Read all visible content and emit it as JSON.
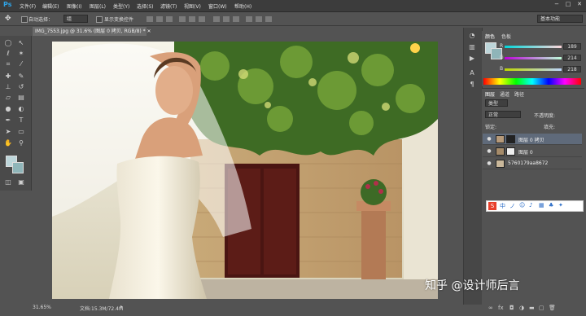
{
  "app": {
    "logo": "Ps"
  },
  "menu": [
    "文件(F)",
    "编辑(E)",
    "图像(I)",
    "图层(L)",
    "类型(Y)",
    "选择(S)",
    "滤镜(T)",
    "视图(V)",
    "窗口(W)",
    "帮助(H)"
  ],
  "window_controls": [
    "−",
    "□",
    "✕"
  ],
  "options": {
    "auto_select_label": "自动选择：",
    "auto_select_value": "组",
    "transform_label": "显示变换控件",
    "workspace": "基本功能"
  },
  "document": {
    "tab_title": "IMG_7553.jpg @ 31.6% (图层 0 拷贝, RGB/8) * ✕"
  },
  "status": {
    "zoom": "31.65%",
    "doc": "文档:15.3M/72.4M"
  },
  "color_panel": {
    "tabs": [
      "颜色",
      "色板"
    ],
    "sliders": [
      {
        "label": "R",
        "value": "189"
      },
      {
        "label": "G",
        "value": "214"
      },
      {
        "label": "B",
        "value": "218"
      }
    ],
    "foreground": "#bdd6da",
    "background": "#8fb5b9"
  },
  "layers_panel": {
    "tabs": [
      "图层",
      "通道",
      "路径"
    ],
    "kind_label": "类型",
    "blend_mode": "正常",
    "opacity_label": "不透明度:",
    "lock_label": "锁定:",
    "fill_label": "填充:",
    "layers": [
      {
        "name": "图层 0 拷贝",
        "selected": true
      },
      {
        "name": "图层 0",
        "selected": false
      },
      {
        "name": "5760179aa8672",
        "selected": false
      }
    ]
  },
  "watermark": "知乎 @设计师后言"
}
